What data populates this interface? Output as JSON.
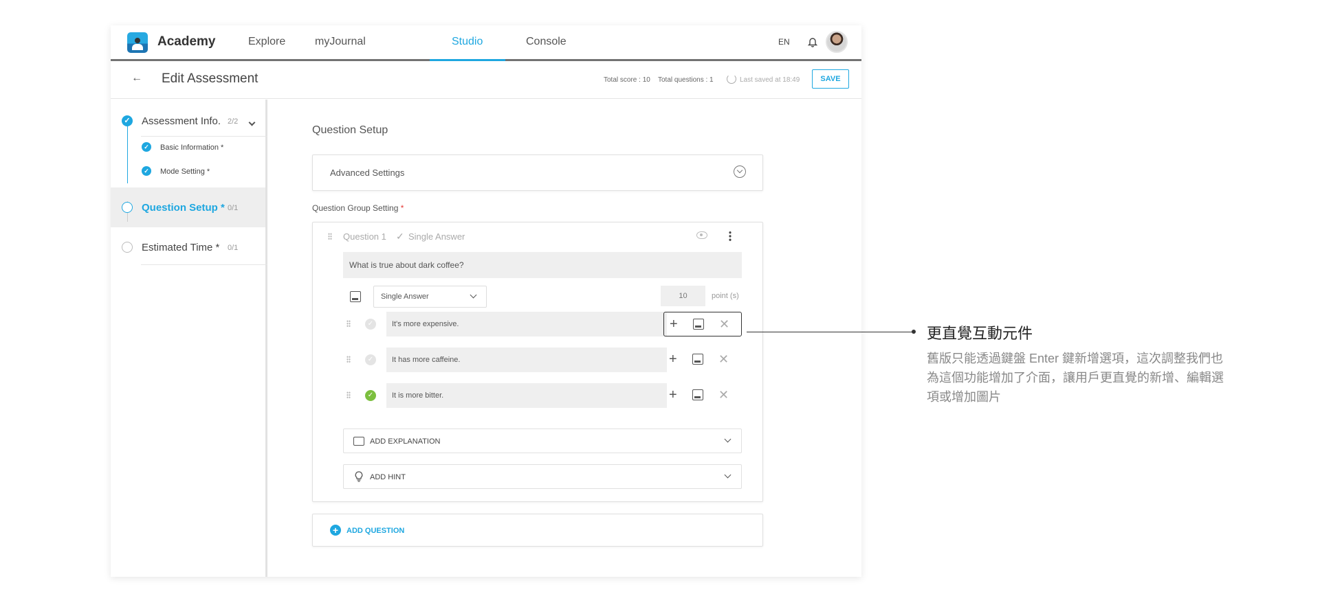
{
  "nav": {
    "brand": "Academy",
    "items": [
      "Explore",
      "myJournal",
      "Studio",
      "Console"
    ],
    "active": "Studio",
    "lang": "EN"
  },
  "header": {
    "title": "Edit Assessment",
    "total_score": "Total score : 10",
    "total_questions": "Total questions : 1",
    "last_saved": "Last saved at 18:49",
    "save_label": "SAVE"
  },
  "sidebar": {
    "steps": [
      {
        "label": "Assessment Info.",
        "count": "2/2",
        "status": "done"
      },
      {
        "label": "Question Setup *",
        "count": "0/1",
        "status": "active"
      },
      {
        "label": "Estimated Time *",
        "count": "0/1",
        "status": "pending"
      }
    ],
    "sub_items": [
      "Basic Information *",
      "Mode Setting *"
    ]
  },
  "main": {
    "section_title": "Question Setup",
    "advanced_settings": "Advanced Settings",
    "group_label": "Question Group Setting",
    "required_mark": "*",
    "question": {
      "label": "Question 1",
      "type_label": "Single Answer",
      "text": "What is true about dark coffee?",
      "answer_type": "Single Answer",
      "points": "10",
      "points_unit": "point (s)",
      "options": [
        {
          "text": "It's more expensive.",
          "correct": false
        },
        {
          "text": "It has more caffeine.",
          "correct": false
        },
        {
          "text": "It is more bitter.",
          "correct": true
        }
      ],
      "add_explanation": "ADD EXPLANATION",
      "add_hint": "ADD HINT"
    },
    "add_question": "ADD QUESTION"
  },
  "annotation": {
    "title": "更直覺互動元件",
    "body": "舊版只能透過鍵盤 Enter 鍵新增選項，這次調整我們也為這個功能增加了介面，讓用戶更直覺的新增、編輯選項或增加圖片"
  },
  "colors": {
    "accent": "#1ea7e0",
    "correct": "#7cbf3f",
    "required": "#e53935"
  }
}
